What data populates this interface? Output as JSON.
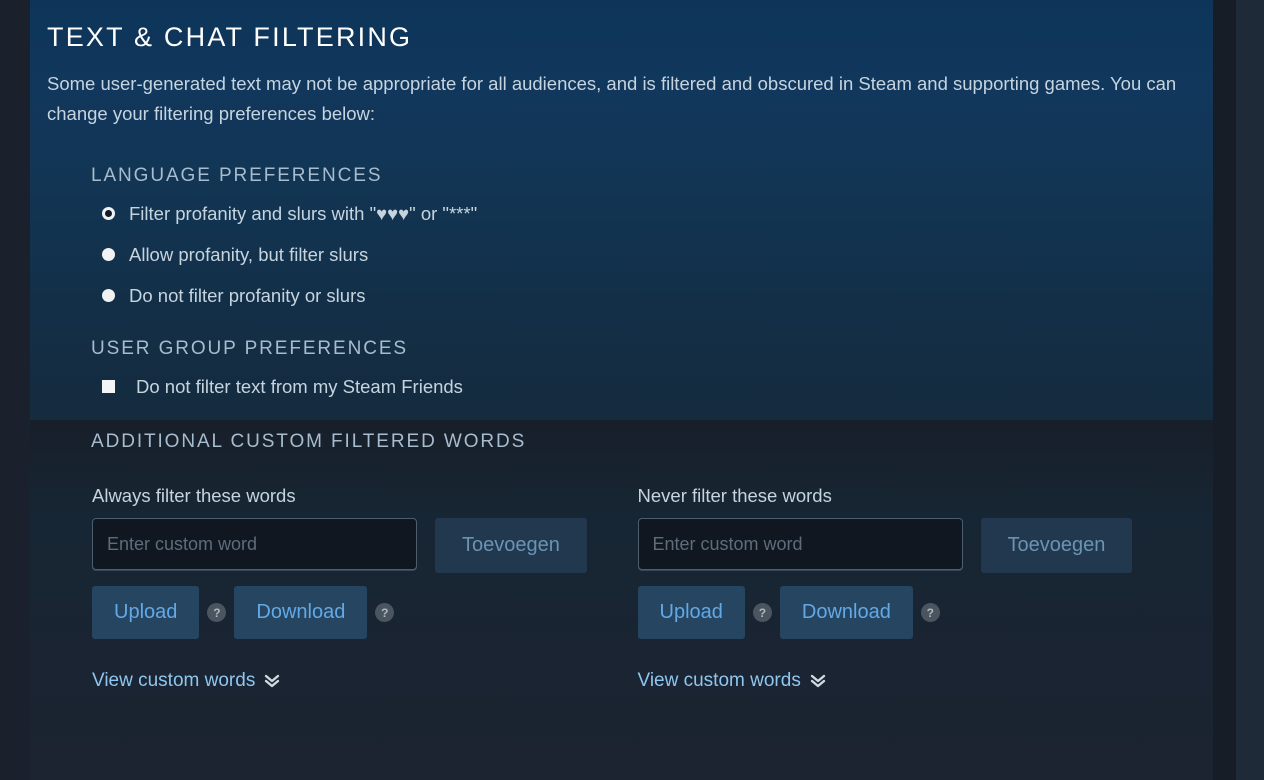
{
  "page": {
    "title": "TEXT & CHAT FILTERING",
    "intro": "Some user-generated text may not be appropriate for all audiences, and is filtered and obscured in Steam and supporting games. You can change your filtering preferences below:"
  },
  "language_preferences": {
    "heading": "LANGUAGE PREFERENCES",
    "options": [
      {
        "label": "Filter profanity and slurs with \"♥♥♥\" or \"***\"",
        "selected": true
      },
      {
        "label": "Allow profanity, but filter slurs",
        "selected": false
      },
      {
        "label": "Do not filter profanity or slurs",
        "selected": false
      }
    ]
  },
  "user_group_preferences": {
    "heading": "USER GROUP PREFERENCES",
    "options": [
      {
        "label": "Do not filter text from my Steam Friends",
        "checked": false
      }
    ]
  },
  "custom_words": {
    "heading": "ADDITIONAL CUSTOM FILTERED WORDS",
    "columns": [
      {
        "label": "Always filter these words",
        "input_value": "",
        "input_placeholder": "Enter custom word",
        "add_label": "Toevoegen",
        "upload_label": "Upload",
        "download_label": "Download",
        "help_glyph": "?",
        "view_label": "View custom words"
      },
      {
        "label": "Never filter these words",
        "input_value": "",
        "input_placeholder": "Enter custom word",
        "add_label": "Toevoegen",
        "upload_label": "Upload",
        "download_label": "Download",
        "help_glyph": "?",
        "view_label": "View custom words"
      }
    ]
  },
  "colors": {
    "panel_top": "#0d3559",
    "panel_bottom": "#1b2430",
    "accent_link": "#63a9e6",
    "body_text": "#c6d4df",
    "heading_text": "#a7bcce",
    "add_button_bg": "#22384e",
    "io_button_bg": "#264560"
  }
}
